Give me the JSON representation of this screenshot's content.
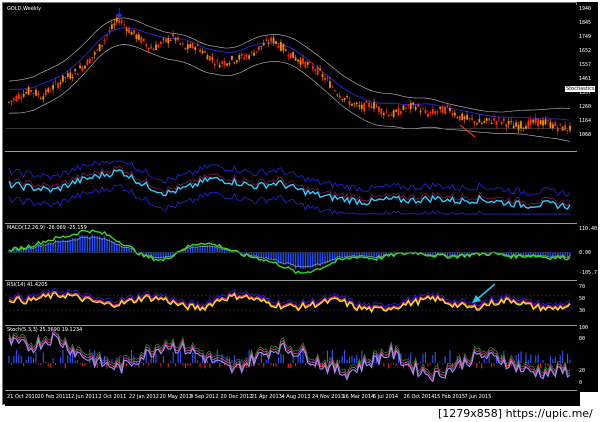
{
  "window": {
    "title": "GOLD,Weekly"
  },
  "panes": {
    "price": {
      "label": "GOLD,Weekly",
      "scale": [
        "1940",
        "1845",
        "1749",
        "1652",
        "1557",
        "1461",
        "1357",
        "1260",
        "1164",
        "1068"
      ],
      "current_price": "1164",
      "indicator_tag": "Stochastics"
    },
    "stoch_bands": {
      "label": ""
    },
    "macd": {
      "label": "MACD(12,26,9) -26.069 -25.159",
      "scale": [
        "110.40",
        "0.00",
        "-105.7"
      ]
    },
    "rsi": {
      "label": "RSI(14) 41.4205",
      "scale": [
        "70",
        "50",
        "30"
      ]
    },
    "stoch": {
      "label": "Stoch(5,3,3) 25.3690 19.1234",
      "scale": [
        "100",
        "80",
        "20",
        "0"
      ]
    }
  },
  "time_axis": {
    "labels": [
      "21 Oct 2010",
      "20 Feb 2011",
      "12 Jun 2011",
      "2 Oct 2011",
      "22 Jan 2012",
      "20 May 2012",
      "9 Sep 2012",
      "20 Dec 2012",
      "21 Apr 2013",
      "4 Aug 2013",
      "24 Nov 2013",
      "16 Mar 2014",
      "6 Jul 2014",
      "26 Oct 2014",
      "15 Feb 2015",
      "7 Jun 2015"
    ]
  },
  "footer": {
    "text": "[1279x858] https://upic.me/"
  },
  "colors": {
    "bull_candle": "#ff8c00",
    "bear_candle": "#ff3300",
    "bands": "#c0c0c0",
    "blue_line": "#2a2aff",
    "cyan_line": "#33ccff",
    "macd_hist": "#1d4fff",
    "macd_green": "#33dd22",
    "rsi_yellow": "#ffee00",
    "rsi_pink": "#ff3399",
    "stoch_blue": "#3355ff",
    "stoch_red": "#ff2200",
    "annotation_arrow": "#22ccee"
  },
  "icons": {
    "top_marker": "arrow-down-icon",
    "annotation": "arrow-up-right-icon"
  },
  "chart_data": [
    {
      "type": "line",
      "title": "GOLD,Weekly",
      "series": [
        {
          "values": [
            1340,
            1390,
            1420,
            1380,
            1440,
            1500,
            1540,
            1600,
            1680,
            1800,
            1900,
            1820,
            1760,
            1700,
            1740,
            1780,
            1700,
            1720,
            1660,
            1600,
            1620,
            1640,
            1660,
            1720,
            1760,
            1700,
            1640,
            1600,
            1560,
            1480,
            1400,
            1340,
            1300,
            1330,
            1280,
            1260,
            1300,
            1320,
            1260,
            1280,
            1300,
            1240,
            1220,
            1200,
            1220,
            1210,
            1180,
            1190,
            1210,
            1200,
            1175,
            1165
          ]
        }
      ],
      "ylim": [
        1068,
        1940
      ]
    },
    {
      "type": "line",
      "series": [
        {
          "values": [
            0.55,
            0.5,
            0.45,
            0.6,
            0.7,
            0.78,
            0.55,
            0.4,
            0.5,
            0.65,
            0.6,
            0.52,
            0.58,
            0.45,
            0.35,
            0.3,
            0.25,
            0.3,
            0.28,
            0.32,
            0.27,
            0.3,
            0.25,
            0.2,
            0.22,
            0.18
          ]
        }
      ]
    },
    {
      "type": "line",
      "title": "MACD(12,26,9) -26.069 -25.159",
      "series": [
        {
          "values": [
            10,
            30,
            60,
            80,
            110,
            90,
            40,
            -20,
            -40,
            20,
            50,
            30,
            -10,
            -30,
            -60,
            -105,
            -80,
            -40,
            -20,
            -30,
            -10,
            0,
            -15,
            -20,
            -10,
            -5,
            -20,
            -15,
            -25,
            -26
          ]
        }
      ],
      "ylim": [
        -105.7,
        110.4
      ]
    },
    {
      "type": "line",
      "title": "RSI(14) 41.4205",
      "series": [
        {
          "values": [
            60,
            55,
            68,
            72,
            58,
            45,
            50,
            65,
            60,
            40,
            35,
            62,
            70,
            55,
            42,
            38,
            48,
            58,
            36,
            30,
            40,
            52,
            62,
            45,
            35,
            50,
            58,
            40,
            33,
            41
          ]
        }
      ],
      "ylim": [
        0,
        100
      ]
    },
    {
      "type": "bar",
      "title": "Stoch(5,3,3) 25.3690 19.1234",
      "series": [
        {
          "values": [
            80,
            70,
            90,
            60,
            40,
            30,
            55,
            75,
            65,
            45,
            25,
            50,
            70,
            60,
            35,
            20,
            40,
            60,
            30,
            15,
            35,
            55,
            45,
            25,
            20,
            25
          ]
        }
      ],
      "ylim": [
        0,
        100
      ]
    }
  ]
}
